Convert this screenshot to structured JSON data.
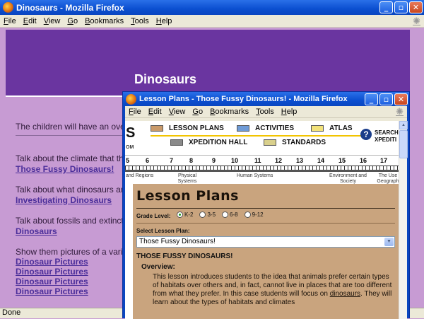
{
  "back_window": {
    "title": "Dinosaurs - Mozilla Firefox",
    "menu": [
      "File",
      "Edit",
      "View",
      "Go",
      "Bookmarks",
      "Tools",
      "Help"
    ],
    "heading": "Dinosaurs",
    "intro": "The children will have an overvie",
    "sections": [
      {
        "text": "Talk about the climate that the",
        "link": "Those Fussy Dinosaurs!"
      },
      {
        "text": "Talk about what dinosaurs are",
        "link": "Investigating Dinosaurs"
      },
      {
        "text": "Talk about fossils and extinctio",
        "link": "Dinosaurs"
      }
    ],
    "pictures_text": "Show them pictures of a varie",
    "picture_links": [
      "Dinosaur Pictures",
      "Dinosaur Pictures",
      "Dinosaur Pictures",
      "Dinosaur Pictures"
    ],
    "status": "Done"
  },
  "front_window": {
    "title": "Lesson Plans - Those Fussy Dinosaurs! - Mozilla Firefox",
    "menu": [
      "File",
      "Edit",
      "View",
      "Go",
      "Bookmarks",
      "Tools",
      "Help"
    ],
    "logo_fragment": "S",
    "logo_small": "OM",
    "nav": [
      {
        "label": "LESSON PLANS",
        "color": "#c99a6a"
      },
      {
        "label": "ACTIVITIES",
        "color": "#6f9bd6"
      },
      {
        "label": "ATLAS",
        "color": "#f2e27a"
      },
      {
        "label": "XPEDITION HALL",
        "color": "#8a8a8a"
      },
      {
        "label": "STANDARDS",
        "color": "#d9d08c"
      }
    ],
    "search_label": "SEARCH",
    "search_sub": "XPEDITI",
    "ruler_numbers": [
      "5",
      "6",
      "7",
      "8",
      "9",
      "10",
      "11",
      "12",
      "13",
      "14",
      "15",
      "16",
      "17"
    ],
    "ruler_labels": [
      "and Regions",
      "Physical Systems",
      "Human Systems",
      "Environment and Society",
      "The Use Geograph"
    ],
    "page_title": "Lesson Plans",
    "grade_label": "Grade Level:",
    "grades": [
      "K-2",
      "3-5",
      "6-8",
      "9-12"
    ],
    "select_label": "Select Lesson Plan:",
    "select_value": "Those Fussy Dinosaurs!",
    "lesson_heading": "THOSE FUSSY DINOSAURS!",
    "overview_label": "Overview:",
    "overview_text_1": "This lesson introduces students to the idea that animals prefer certain types of habitats over others and, in fact, cannot live in places that are too different from what they prefer. In this case students will focus on",
    "overview_link": "dinosaurs",
    "overview_text_2": ". They will learn about the types of habitats and climates"
  }
}
